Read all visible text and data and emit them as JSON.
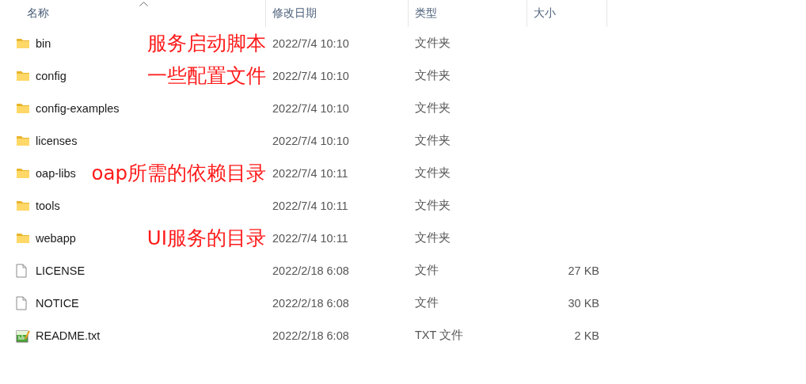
{
  "columns": [
    {
      "label": "名称",
      "sorted": true
    },
    {
      "label": "修改日期",
      "sorted": false
    },
    {
      "label": "类型",
      "sorted": false
    },
    {
      "label": "大小",
      "sorted": false
    }
  ],
  "rows": [
    {
      "kind": "folder",
      "name": "bin",
      "note": "服务启动脚本",
      "date": "2022/7/4 10:10",
      "type": "文件夹"
    },
    {
      "kind": "folder",
      "name": "config",
      "note": "一些配置文件",
      "date": "2022/7/4 10:10",
      "type": "文件夹"
    },
    {
      "kind": "folder",
      "name": "config-examples",
      "date": "2022/7/4 10:10",
      "type": "文件夹"
    },
    {
      "kind": "folder",
      "name": "licenses",
      "date": "2022/7/4 10:10",
      "type": "文件夹"
    },
    {
      "kind": "folder",
      "name": "oap-libs",
      "note": "oap所需的依赖目录",
      "date": "2022/7/4 10:11",
      "type": "文件夹"
    },
    {
      "kind": "folder",
      "name": "tools",
      "date": "2022/7/4 10:11",
      "type": "文件夹"
    },
    {
      "kind": "folder",
      "name": "webapp",
      "note": "UI服务的目录",
      "date": "2022/7/4 10:11",
      "type": "文件夹"
    },
    {
      "kind": "file",
      "name": "LICENSE",
      "date": "2022/2/18 6:08",
      "type": "文件",
      "size": "27 KB"
    },
    {
      "kind": "file",
      "name": "NOTICE",
      "date": "2022/2/18 6:08",
      "type": "文件",
      "size": "30 KB"
    },
    {
      "kind": "text",
      "name": "README.txt",
      "date": "2022/2/18 6:08",
      "type": "TXT 文件",
      "size": "2 KB"
    }
  ]
}
